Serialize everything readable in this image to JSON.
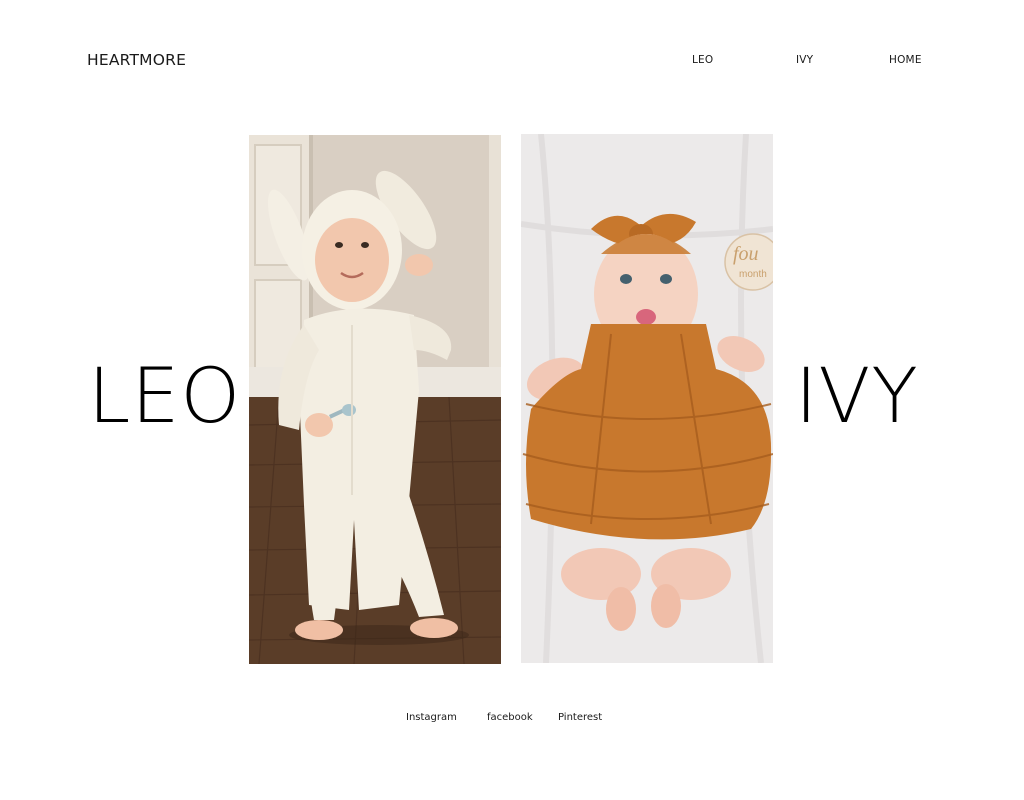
{
  "header": {
    "brand": "HEARTMORE",
    "nav": [
      {
        "label": "LEO"
      },
      {
        "label": "IVY"
      },
      {
        "label": "HOME"
      }
    ]
  },
  "main": {
    "left_title": "LEO",
    "right_title": "IVY",
    "photos": [
      {
        "alt": "Toddler in bunny ears hat and cream onesie standing on wood floor holding a spoon"
      },
      {
        "alt": "Baby in orange ruffled dress and headband lying on white blanket beside a four months milestone sign"
      }
    ],
    "milestone_sign": [
      "fou",
      "month"
    ]
  },
  "footer": {
    "social": [
      {
        "label": "Instagram"
      },
      {
        "label": "facebook"
      },
      {
        "label": "Pinterest"
      }
    ]
  }
}
